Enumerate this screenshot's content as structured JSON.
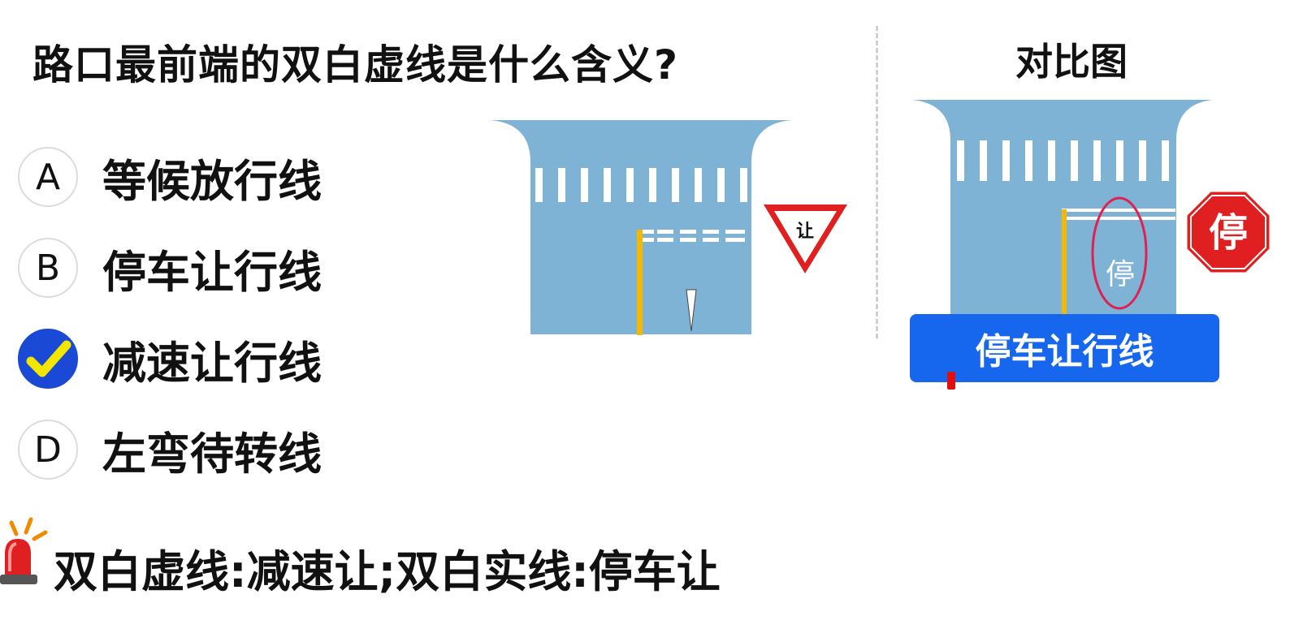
{
  "question": "路口最前端的双白虚线是什么含义?",
  "options": [
    {
      "letter": "A",
      "text": "等候放行线",
      "correct": false
    },
    {
      "letter": "B",
      "text": "停车让行线",
      "correct": false
    },
    {
      "letter": "C",
      "text": "减速让行线",
      "correct": true
    },
    {
      "letter": "D",
      "text": "左弯待转线",
      "correct": false
    }
  ],
  "compare": {
    "title": "对比图",
    "yield_sign_text": "让",
    "stop_sign_text": "停",
    "road_marking_text": "停",
    "banner_text": "停车让行线"
  },
  "tip": "双白虚线:减速让;双白实线:停车让",
  "colors": {
    "road": "#7fb3d5",
    "yellow_line": "#f5b800",
    "correct_badge": "#1a49d6",
    "check": "#f3e600",
    "banner": "#1667ee",
    "sign_red": "#e02020"
  },
  "icons": {
    "check": "check-icon",
    "alarm": "alarm-siren-icon",
    "yield": "yield-sign-icon",
    "stop": "stop-sign-icon"
  }
}
